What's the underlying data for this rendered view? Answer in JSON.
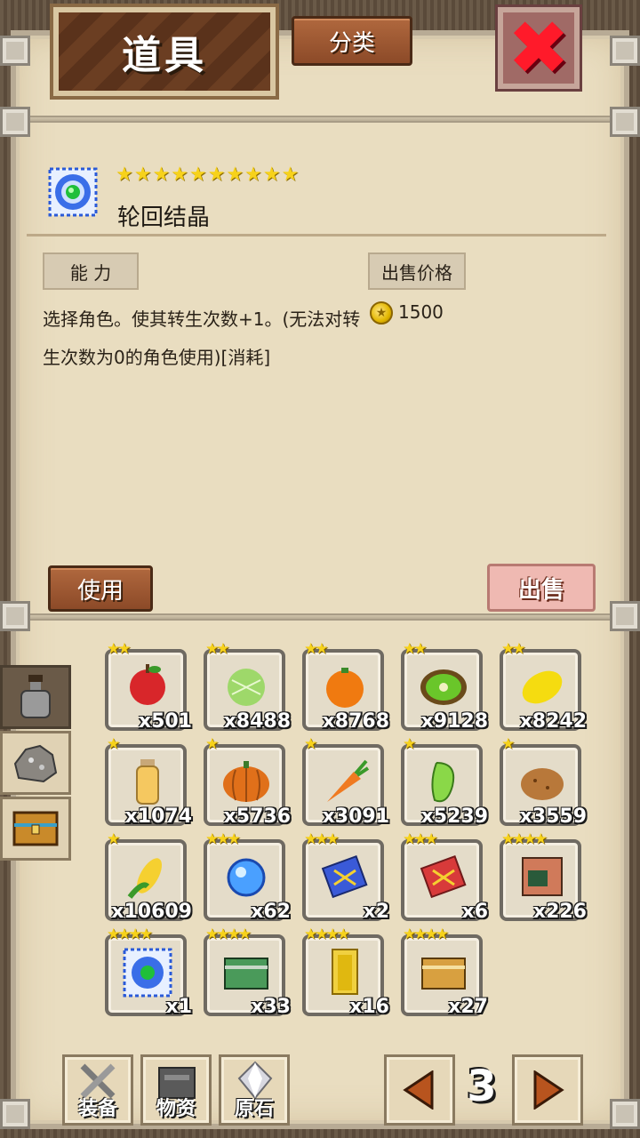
{
  "title": "道具",
  "category_button": "分类",
  "close_button": "✖",
  "item": {
    "stars": "★★★★★★★★★★",
    "name": "轮回结晶",
    "ability_label": "能 力",
    "sell_price_label": "出售价格",
    "price": "1500",
    "description": "选择角色。使其转生次数+1。(无法对转生次数为0的角色使用)[消耗]",
    "use_button": "使用",
    "sell_button": "出售"
  },
  "side_tabs": [
    "potion-tab",
    "ore-tab",
    "chest-tab"
  ],
  "inventory": [
    {
      "icon": "apple-icon",
      "stars": "★★",
      "qty": "x501"
    },
    {
      "icon": "melon-icon",
      "stars": "★★",
      "qty": "x8488"
    },
    {
      "icon": "orange-icon",
      "stars": "★★",
      "qty": "x8768"
    },
    {
      "icon": "kiwi-icon",
      "stars": "★★",
      "qty": "x9128"
    },
    {
      "icon": "lemon-icon",
      "stars": "★★",
      "qty": "x8242"
    },
    {
      "icon": "juice-bottle-icon",
      "stars": "★",
      "qty": "x1074"
    },
    {
      "icon": "pumpkin-icon",
      "stars": "★",
      "qty": "x5736"
    },
    {
      "icon": "carrot-icon",
      "stars": "★",
      "qty": "x3091"
    },
    {
      "icon": "pepper-icon",
      "stars": "★",
      "qty": "x5239"
    },
    {
      "icon": "potato-icon",
      "stars": "★",
      "qty": "x3559"
    },
    {
      "icon": "corn-icon",
      "stars": "★",
      "qty": "x10609"
    },
    {
      "icon": "orb-icon",
      "stars": "★★★",
      "qty": "x62"
    },
    {
      "icon": "blue-scroll-icon",
      "stars": "★★★",
      "qty": "x2"
    },
    {
      "icon": "red-scroll-icon",
      "stars": "★★★",
      "qty": "x6"
    },
    {
      "icon": "machine-icon",
      "stars": "★★★★",
      "qty": "x226"
    },
    {
      "icon": "crystal-icon",
      "stars": "★★★★",
      "qty": "x1"
    },
    {
      "icon": "green-chest-icon",
      "stars": "★★★★",
      "qty": "x33"
    },
    {
      "icon": "gold-door-icon",
      "stars": "★★★★",
      "qty": "x16"
    },
    {
      "icon": "gold-chest-icon",
      "stars": "★★★★",
      "qty": "x27"
    }
  ],
  "bottom_nav": {
    "equipment": "装备",
    "materials": "物资",
    "ore": "原石",
    "page": "3"
  }
}
